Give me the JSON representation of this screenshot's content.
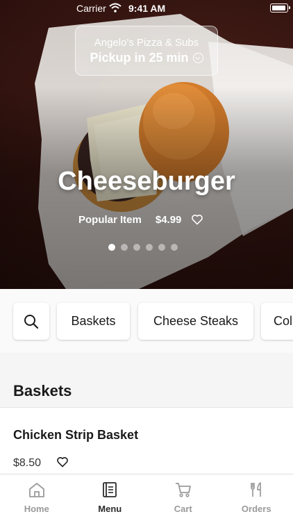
{
  "status_bar": {
    "carrier": "Carrier",
    "time": "9:41 AM"
  },
  "hero": {
    "restaurant": "Angelo's Pizza & Subs",
    "pickup": "Pickup in 25 min",
    "item_title": "Cheeseburger",
    "badge": "Popular Item",
    "price": "$4.99",
    "page_count": 6,
    "active_page": 1
  },
  "categories": {
    "search_icon": "search-icon",
    "items": [
      "Baskets",
      "Cheese Steaks",
      "Col"
    ]
  },
  "section": {
    "title": "Baskets",
    "items": [
      {
        "name": "Chicken Strip Basket",
        "price": "$8.50"
      }
    ]
  },
  "tabbar": {
    "tabs": [
      {
        "label": "Home",
        "icon": "home-icon"
      },
      {
        "label": "Menu",
        "icon": "menu-book-icon"
      },
      {
        "label": "Cart",
        "icon": "cart-icon"
      },
      {
        "label": "Orders",
        "icon": "fork-knife-icon"
      }
    ],
    "active": "Menu"
  },
  "colors": {
    "active_tab": "#2b2b2b",
    "inactive_tab": "#9a9a9a",
    "hero_bg": "#3a1712"
  }
}
